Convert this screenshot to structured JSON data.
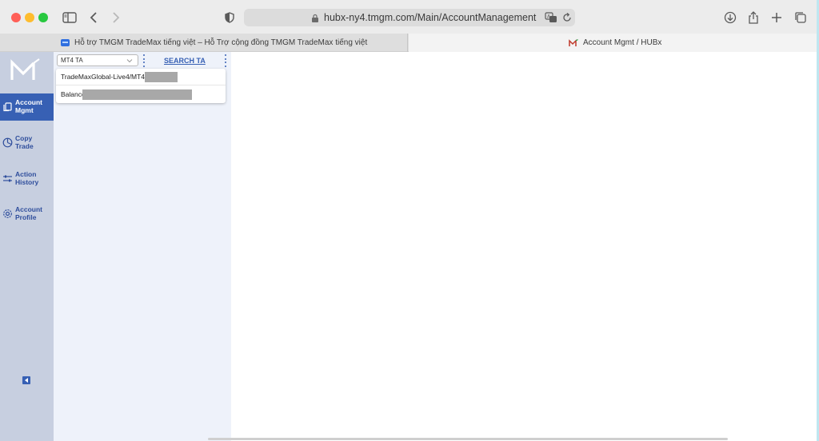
{
  "browser": {
    "url": "hubx-ny4.tmgm.com/Main/AccountManagement",
    "tabs": [
      {
        "label": "Hỗ trợ TMGM TradeMax tiếng việt – Hỗ Trợ cộng đồng TMGM TradeMax tiếng việt",
        "active": false
      },
      {
        "label": "Account Mgmt / HUBx",
        "active": true
      }
    ]
  },
  "sidebar": {
    "items": [
      {
        "label": "Account Mgmt",
        "icon": "copy-icon",
        "active": true
      },
      {
        "label": "Copy Trade",
        "icon": "chart-pie-icon",
        "active": false
      },
      {
        "label": "Action History",
        "icon": "sliders-icon",
        "active": false
      },
      {
        "label": "Account Profile",
        "icon": "gear-icon",
        "active": false
      }
    ]
  },
  "panel": {
    "account_type": "MT4 TA",
    "search_label": "SEARCH TA",
    "server_label": "TradeMaxGlobal-Live4/MT4",
    "balance_label": "Balance"
  },
  "colors": {
    "accent": "#3760b4",
    "sidebar_bg": "#c7cfe0",
    "panel_bg": "#eef2fa"
  }
}
